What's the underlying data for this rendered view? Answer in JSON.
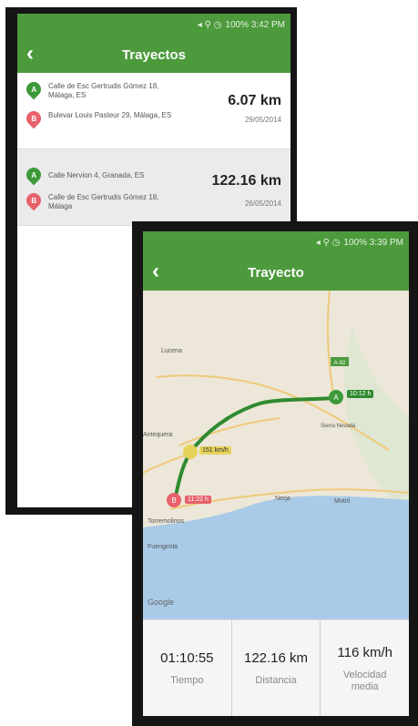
{
  "screen1": {
    "status": {
      "text": "100% 3:42 PM"
    },
    "title": "Trayectos",
    "trips": [
      {
        "start_marker": "A",
        "start": "Calle de Esc Gertrudis Gómez 18, Málaga, ES",
        "end_marker": "B",
        "end": "Bulevar Louis Pasteur 29, Málaga, ES",
        "distance": "6.07 km",
        "date": "29/05/2014"
      },
      {
        "start_marker": "A",
        "start": "Calle Nervion 4, Granada, ES",
        "end_marker": "B",
        "end": "Calle de Esc Gertrudis Gómez 18, Málaga",
        "distance": "122.16 km",
        "date": "26/05/2014"
      }
    ]
  },
  "screen2": {
    "status": {
      "text": "100% 3:39 PM"
    },
    "title": "Trayecto",
    "map": {
      "places": [
        "Lucena",
        "A-92",
        "Antequera",
        "Sierra Nevada",
        "Nerja",
        "Motril",
        "Torremolinos",
        "Fuengirola",
        "Google"
      ],
      "tags": {
        "start": "10:12 h",
        "mid": "151 km/h",
        "end": "11:22 h"
      },
      "marker_labels": {
        "start": "A",
        "mid": "",
        "end": "B"
      }
    },
    "stats": [
      {
        "value": "01:10:55",
        "label": "Tiempo"
      },
      {
        "value": "122.16 km",
        "label": "Distancia"
      },
      {
        "value": "116 km/h",
        "label": "Velocidad media"
      }
    ]
  },
  "colors": {
    "primary": "#4c9a3c",
    "route": "#2f8a2f",
    "marker_start": "#3d9a3a",
    "marker_end": "#e8616b",
    "marker_mid": "#e6d25a",
    "sea": "#a9cbe7"
  }
}
